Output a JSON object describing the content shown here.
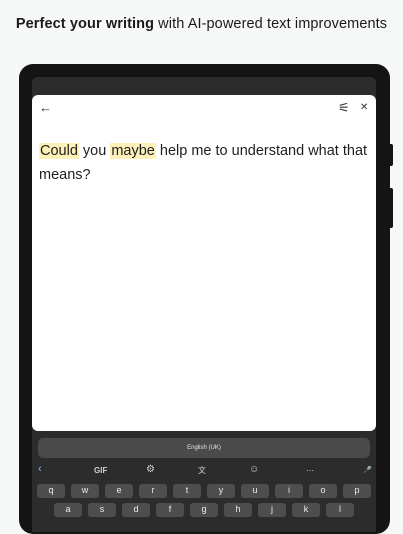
{
  "headline": {
    "bold": "Perfect your writing",
    "rest": " with AI-powered text improvements"
  },
  "editor": {
    "words": [
      {
        "text": "Could",
        "highlight": true
      },
      {
        "text": " you ",
        "highlight": false
      },
      {
        "text": "maybe",
        "highlight": true
      },
      {
        "text": " help me to understand what that means?",
        "highlight": false
      }
    ]
  },
  "icons": {
    "back": "←",
    "settings": "⚟",
    "close": "✕"
  },
  "keyboard": {
    "language": "English (UK)",
    "toolbar": {
      "collapse": "‹",
      "gif": "GIF",
      "settings": "⚙",
      "translate": "文",
      "sticker": "☺",
      "more": "⋯",
      "mic": "🎤"
    },
    "row1": [
      "q",
      "w",
      "e",
      "r",
      "t",
      "y",
      "u",
      "i",
      "o",
      "p"
    ],
    "row2": [
      "a",
      "s",
      "d",
      "f",
      "g",
      "h",
      "j",
      "k",
      "l"
    ]
  }
}
